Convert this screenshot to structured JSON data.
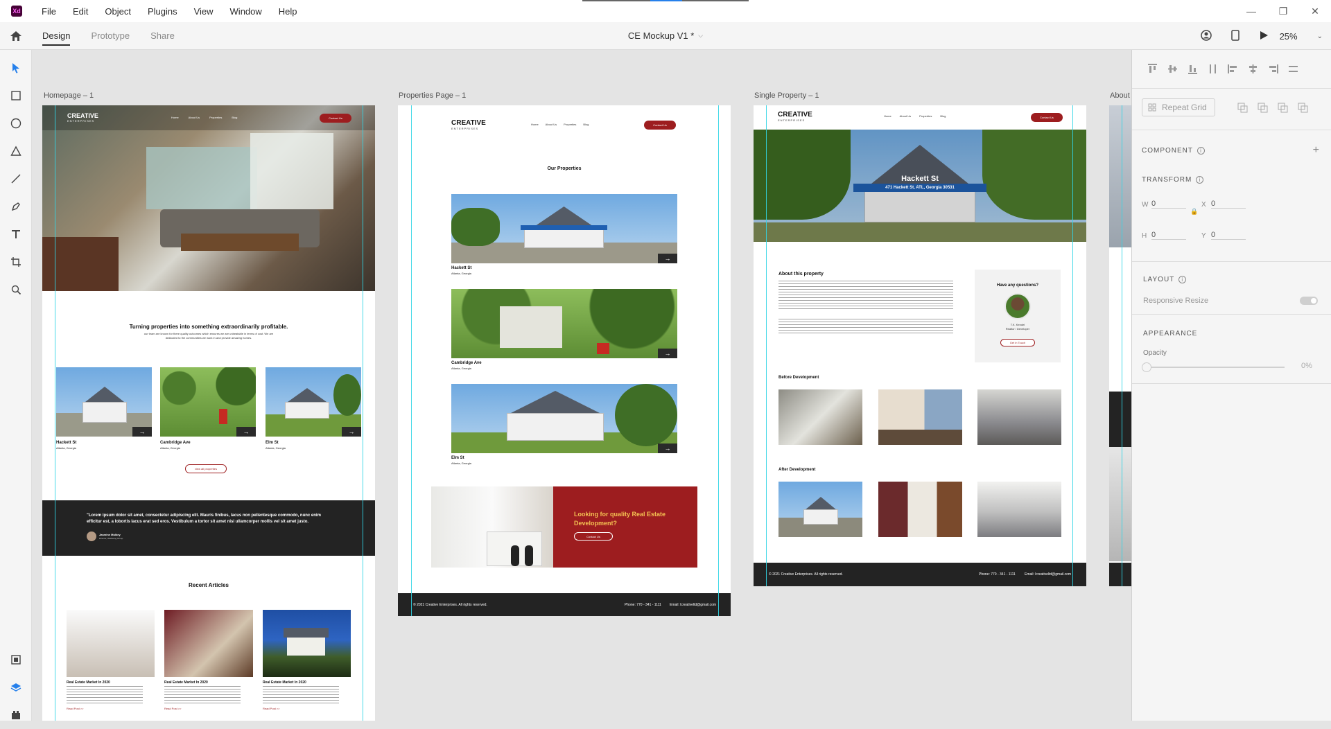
{
  "app": {
    "logo": "Xd",
    "menu": [
      "File",
      "Edit",
      "Object",
      "Plugins",
      "View",
      "Window",
      "Help"
    ]
  },
  "tabs": {
    "design": "Design",
    "prototype": "Prototype",
    "share": "Share"
  },
  "doc": {
    "title": "CE Mockup V1 *"
  },
  "zoom": "25%",
  "artboards": {
    "home": "Homepage – 1",
    "props": "Properties Page – 1",
    "single": "Single Property – 1",
    "about": "About"
  },
  "site": {
    "brand": "CREATIVE",
    "brand_sub": "ENTERPRISES",
    "nav": [
      "Home",
      "About Us",
      "Properties",
      "Blog"
    ],
    "contact_btn": "Contact Us",
    "home_heading": "Turning properties into something extraordinarily profitable.",
    "home_sub": "our team are known for there quality outcomes which ensures we are unbeatable in terms of cost. We are dedicated to the communities we work in and provide amazing homes.",
    "properties": [
      {
        "name": "Hackett St",
        "city": "Atlanta, Georgia"
      },
      {
        "name": "Cambridge Ave",
        "city": "Atlanta, Georgia"
      },
      {
        "name": "Elm St",
        "city": "Atlanta, Georgia"
      }
    ],
    "view_all": "view all properties",
    "quote": "\"Lorem ipsum dolor sit amet, consectetur adipiscing elit. Mauris finibus, lacus non pellentesque commodo, nunc enim efficitur est, a lobortis lacus erat sed eros. Vestibulum a tortor sit amet nisi ullamcorper mollis vel sit amet justo.",
    "quote_author": "Jasmine Mulkey",
    "quote_role": "Director, Wellbeing Group",
    "recent_articles": "Recent Articles",
    "article_title": "Real Estate Market In 2020",
    "read_more": "Read Post >>",
    "our_properties": "Our Properties",
    "cta": "Looking for quality Real Estate Development?",
    "copyright": "© 2021 Creative Enterprises. All rights reserved.",
    "phone": "Phone: 770 - 341 - 1111",
    "email": "Email: lcreativeltd@gmail.com",
    "single_title": "Hackett St",
    "single_address": "471 Hackett St, ATL, Georgia 30531",
    "about_property": "About this property",
    "questions": "Have any questions?",
    "agent_name": "T.K. Kendel",
    "agent_role": "Realtor / Developer",
    "get_in_touch": "Get in Touch",
    "before": "Before Development",
    "after": "After Development"
  },
  "panel": {
    "repeat_grid": "Repeat Grid",
    "component": "COMPONENT",
    "transform": "TRANSFORM",
    "w_label": "W",
    "w_val": "0",
    "x_label": "X",
    "x_val": "0",
    "h_label": "H",
    "h_val": "0",
    "y_label": "Y",
    "y_val": "0",
    "layout": "LAYOUT",
    "responsive": "Responsive Resize",
    "appearance": "APPEARANCE",
    "opacity_label": "Opacity",
    "opacity_val": "0%"
  },
  "colors": {
    "brand_red": "#9d1d1f",
    "guide": "#31d5e6",
    "dark": "#232323"
  }
}
